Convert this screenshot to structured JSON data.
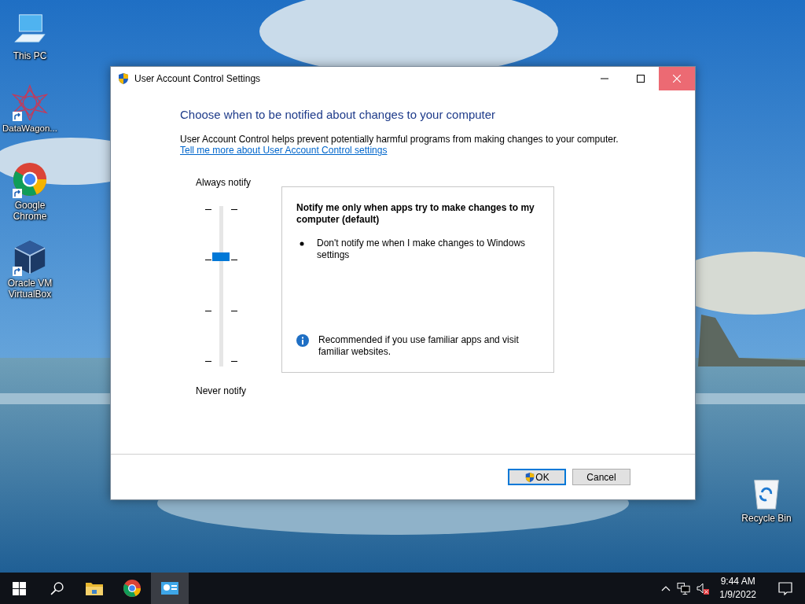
{
  "desktop_icons": [
    {
      "kind": "pc",
      "label": "This PC",
      "shortcut": false
    },
    {
      "kind": "star",
      "label": "DataWagon...",
      "shortcut": true
    },
    {
      "kind": "chrome",
      "label": "Google Chrome",
      "shortcut": true
    },
    {
      "kind": "cube",
      "label": "Oracle VM VirtualBox",
      "shortcut": true
    },
    {
      "kind": "bin",
      "label": "Recycle Bin",
      "shortcut": false
    }
  ],
  "window": {
    "title": "User Account Control Settings",
    "heading": "Choose when to be notified about changes to your computer",
    "description": "User Account Control helps prevent potentially harmful programs from making changes to your computer.",
    "link": "Tell me more about User Account Control settings",
    "slider": {
      "top_label": "Always notify",
      "bottom_label": "Never notify",
      "level": 0.667
    },
    "panel": {
      "title": "Notify me only when apps try to make changes to my computer (default)",
      "bullets": [
        "Don't notify me when I make changes to Windows settings"
      ],
      "note": "Recommended if you use familiar apps and visit familiar websites."
    },
    "buttons": [
      {
        "kind": "ok",
        "label": "OK",
        "focused": true
      },
      {
        "kind": "cancel",
        "label": "Cancel",
        "focused": false
      }
    ]
  },
  "taskbar": {
    "items": [
      {
        "kind": "start",
        "active": false
      },
      {
        "kind": "search",
        "active": false
      },
      {
        "kind": "folder",
        "active": false
      },
      {
        "kind": "chrome",
        "active": false
      },
      {
        "kind": "uac",
        "active": true
      }
    ],
    "time": "9:44 AM",
    "date": "1/9/2022"
  }
}
